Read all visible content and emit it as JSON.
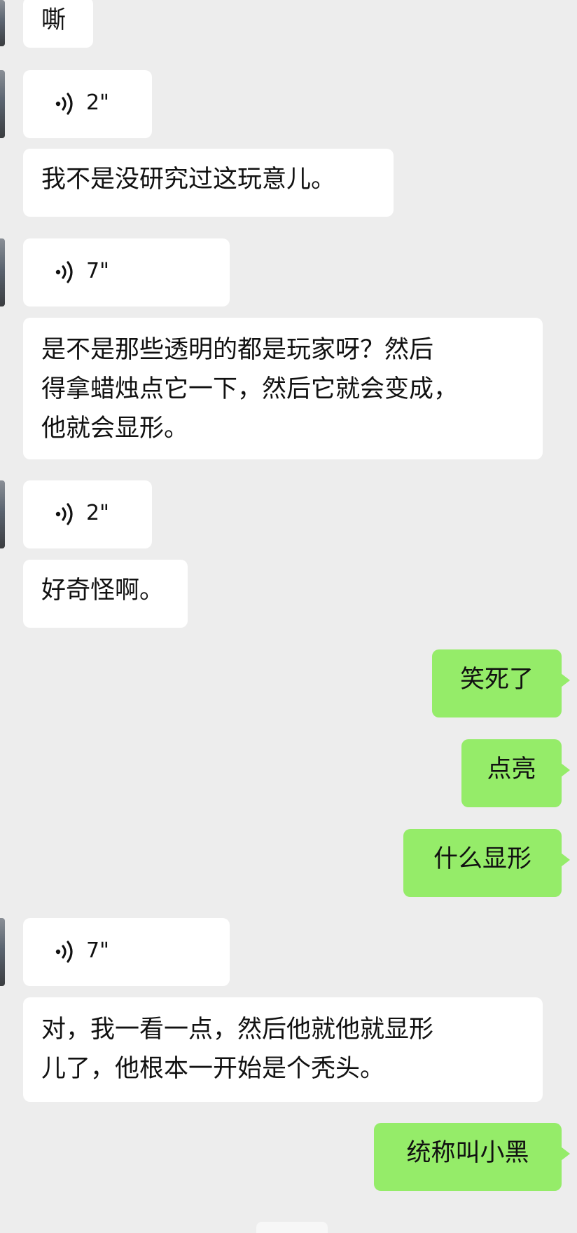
{
  "app": "WeChat chat",
  "colors": {
    "background": "#ededed",
    "incoming_bubble": "#ffffff",
    "outgoing_bubble": "#95ec69",
    "text": "#111111"
  },
  "messages": [
    {
      "id": "m0",
      "side": "left",
      "type": "text",
      "text": "嘶"
    },
    {
      "id": "m1",
      "side": "left",
      "type": "voice",
      "icon": "voice-wave-icon",
      "duration": "2\""
    },
    {
      "id": "m2",
      "side": "left",
      "type": "text",
      "text": "我不是没研究过这玩意儿。"
    },
    {
      "id": "m3",
      "side": "left",
      "type": "voice",
      "icon": "voice-wave-icon",
      "duration": "7\""
    },
    {
      "id": "m4",
      "side": "left",
      "type": "text",
      "text": "是不是那些透明的都是玩家呀？然后\n得拿蜡烛点它一下，然后它就会变成，\n他就会显形。"
    },
    {
      "id": "m5",
      "side": "left",
      "type": "voice",
      "icon": "voice-wave-icon",
      "duration": "2\""
    },
    {
      "id": "m6",
      "side": "left",
      "type": "text",
      "text": "好奇怪啊。"
    },
    {
      "id": "m7",
      "side": "right",
      "type": "text",
      "text": "笑死了"
    },
    {
      "id": "m8",
      "side": "right",
      "type": "text",
      "text": "点亮"
    },
    {
      "id": "m9",
      "side": "right",
      "type": "text",
      "text": "什么显形"
    },
    {
      "id": "m10",
      "side": "left",
      "type": "voice",
      "icon": "voice-wave-icon",
      "duration": "7\""
    },
    {
      "id": "m11",
      "side": "left",
      "type": "text",
      "text": "对，我一看一点，然后他就他就显形\n儿了，他根本一开始是个秃头。"
    },
    {
      "id": "m12",
      "side": "right",
      "type": "text",
      "text": "统称叫小黑"
    }
  ]
}
